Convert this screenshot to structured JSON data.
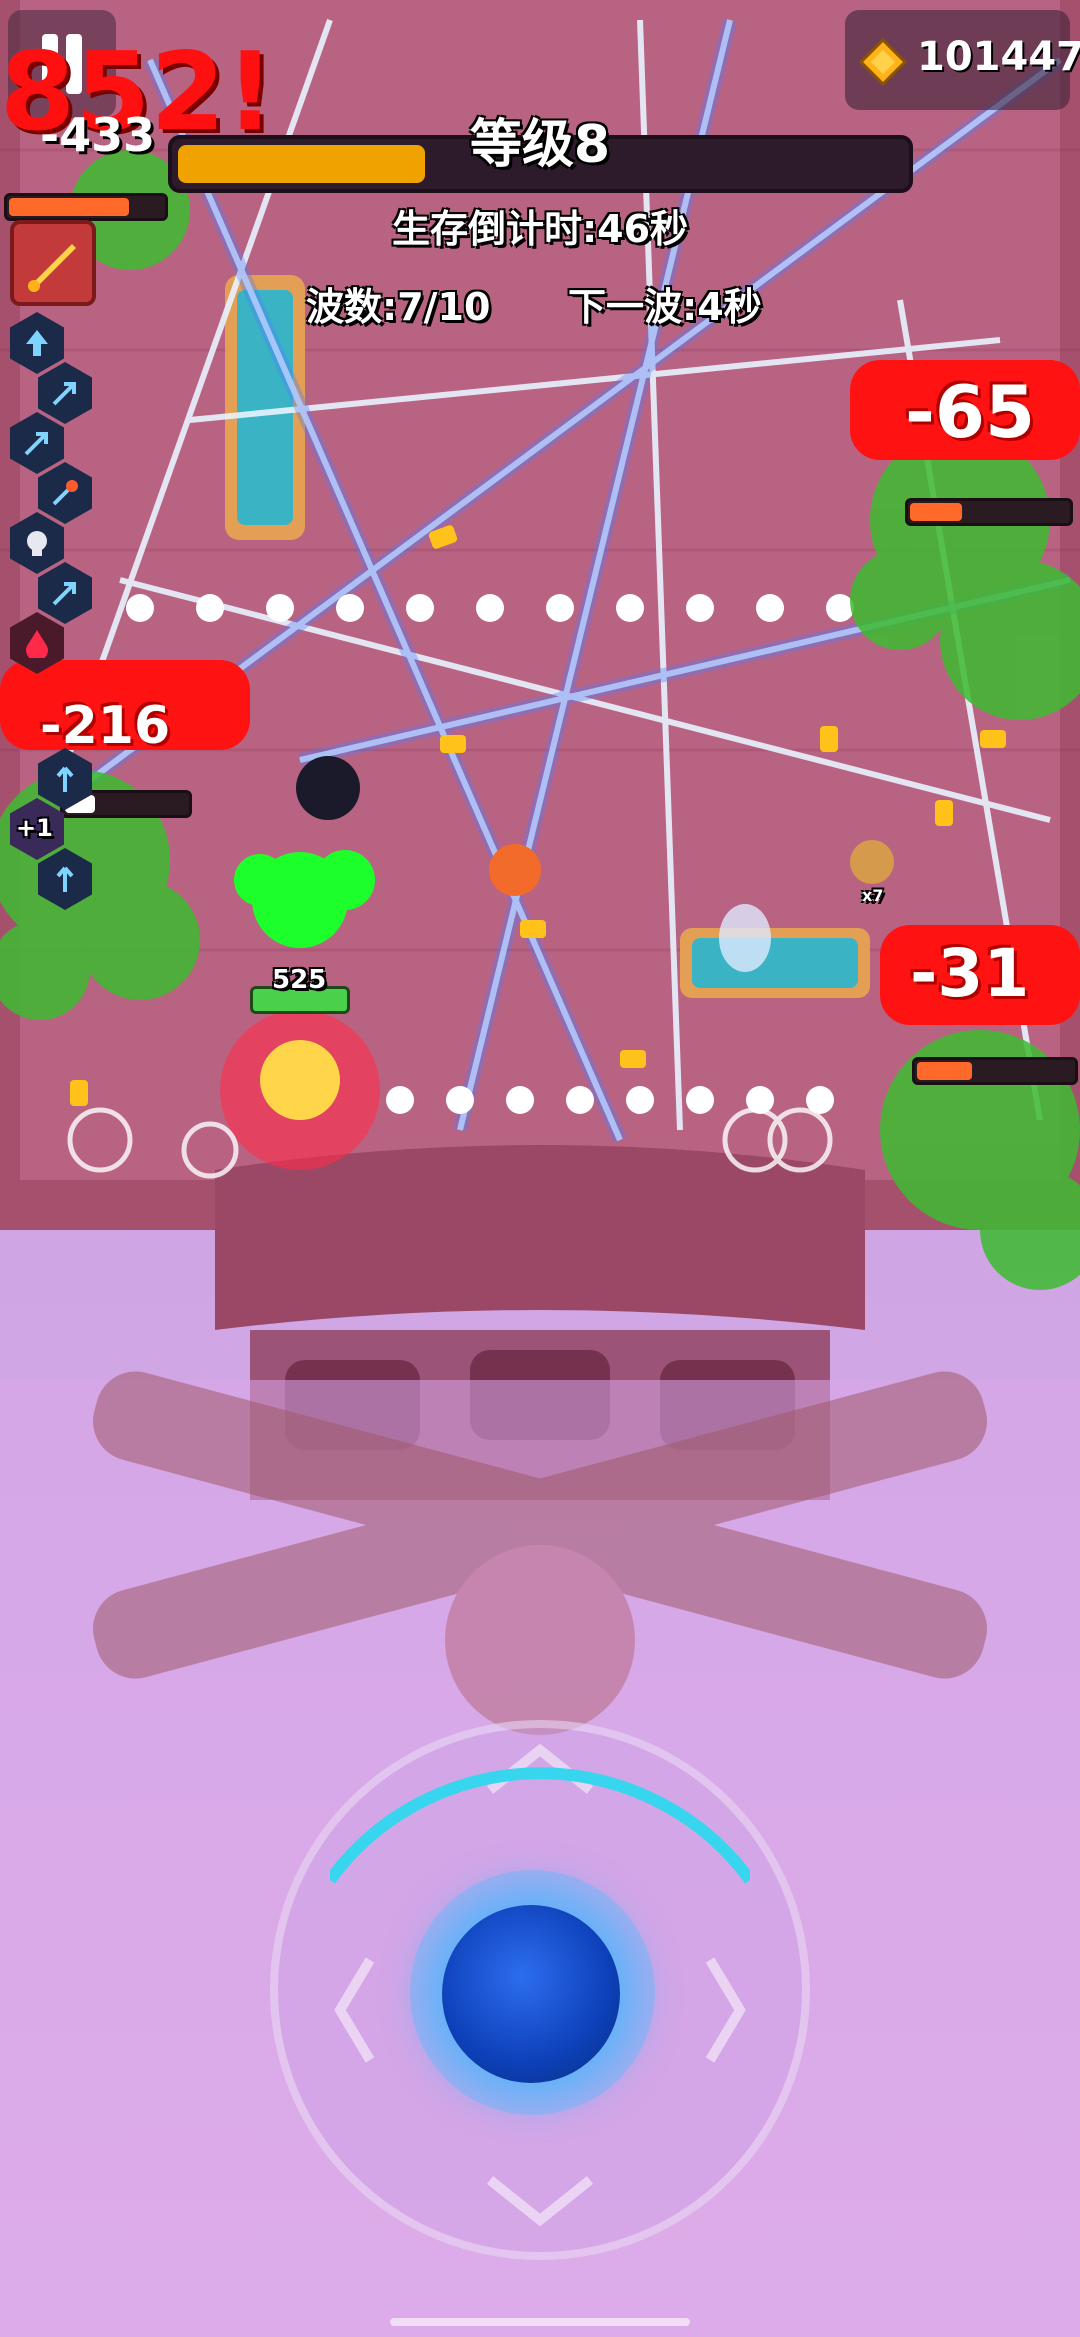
{
  "hud": {
    "level_label": "等级8",
    "xp_progress": 0.34,
    "survival_timer": "生存倒计时:46秒",
    "wave": "波数:7/10",
    "next_wave": "下一波:4秒",
    "coins": "101447"
  },
  "player": {
    "hp": "525"
  },
  "floating_text": {
    "big_combo": "852!",
    "minus_433": "-433",
    "minus_216": "-216",
    "minus_65": "-65",
    "minus_31": "-31"
  },
  "skills": {
    "plus_one": "+1"
  },
  "items": {
    "cookie_count": "x7"
  },
  "colors": {
    "xp_fill": "#f0a200",
    "joystick": "#0d40b8",
    "damage": "#ff1b1b",
    "floor": "#c99ee0"
  }
}
